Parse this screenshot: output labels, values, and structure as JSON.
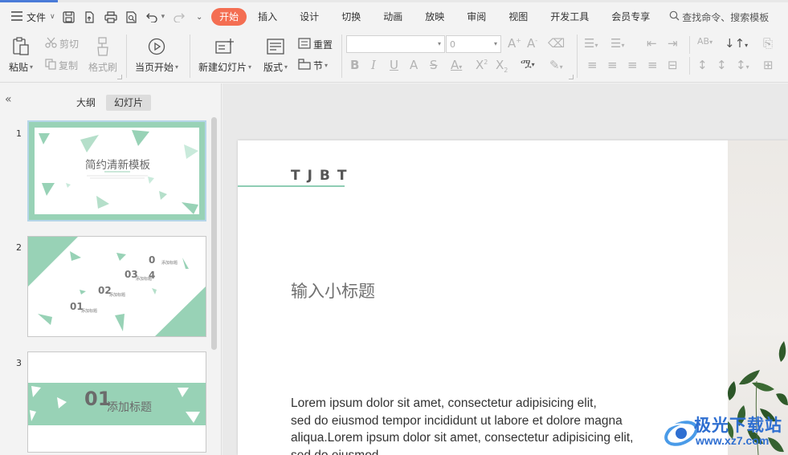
{
  "menubar": {
    "file_label": "文件",
    "tabs": [
      "开始",
      "插入",
      "设计",
      "切换",
      "动画",
      "放映",
      "审阅",
      "视图",
      "开发工具",
      "会员专享"
    ],
    "active_tab": "开始",
    "search_placeholder": "查找命令、搜索模板"
  },
  "ribbon": {
    "paste": "粘贴",
    "cut": "剪切",
    "copy": "复制",
    "format_painter": "格式刷",
    "from_current": "当页开始",
    "new_slide": "新建幻灯片",
    "layout": "版式",
    "reset": "重置",
    "section": "节",
    "font_size": "0"
  },
  "leftpanel": {
    "tab_outline": "大纲",
    "tab_slides": "幻灯片",
    "slides": [
      {
        "number": "1",
        "title": "简约清新模板"
      },
      {
        "number": "2",
        "items": [
          "01",
          "02",
          "03",
          "04"
        ],
        "item_label": "添加标题"
      },
      {
        "number": "3",
        "title_num": "01",
        "title_text": "添加标题"
      }
    ]
  },
  "slide": {
    "brand": "TJBT",
    "subtitle": "输入小标题",
    "body_lines": [
      "Lorem ipsum dolor sit amet, consectetur adipisicing elit,",
      "sed do eiusmod tempor incididunt ut labore et dolore magna",
      "aliqua.Lorem ipsum dolor sit amet, consectetur adipisicing elit,",
      "sed do eiusmod"
    ]
  },
  "watermark": {
    "text": "极光下载站",
    "url": "www.xz7.com"
  },
  "colors": {
    "accent_tab": "#f46e52",
    "mint": "#98d2b6",
    "watermark_blue": "#2f6fd1"
  }
}
